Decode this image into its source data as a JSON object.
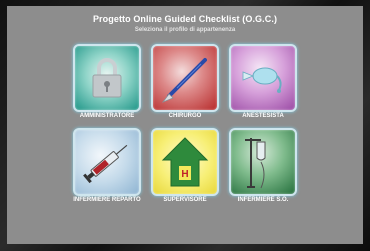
{
  "header": {
    "title": "Progetto Online Guided Checklist (O.G.C.)",
    "subtitle": "Seleziona il profilo di appartenenza"
  },
  "profiles": [
    {
      "label": "AMMINISTRATORE",
      "icon": "lock-icon"
    },
    {
      "label": "CHIRURGO",
      "icon": "scalpel-icon"
    },
    {
      "label": "ANESTESISTA",
      "icon": "breathing-bag-icon"
    },
    {
      "label": "INFERMIERE REPARTO",
      "icon": "syringe-icon"
    },
    {
      "label": "SUPERVISORE",
      "icon": "hospital-house-icon"
    },
    {
      "label": "INFERMIERE S.O.",
      "icon": "iv-drip-icon"
    }
  ],
  "colors": {
    "panel": "#8d8d8d",
    "amministratore": "#2fa89a",
    "chirurgo": "#c43a3a",
    "anestesista": "#b05fb8",
    "infermiere_reparto": "#9ec2dc",
    "supervisore": "#f3e95a",
    "infermiere_so": "#2f8a4e"
  }
}
